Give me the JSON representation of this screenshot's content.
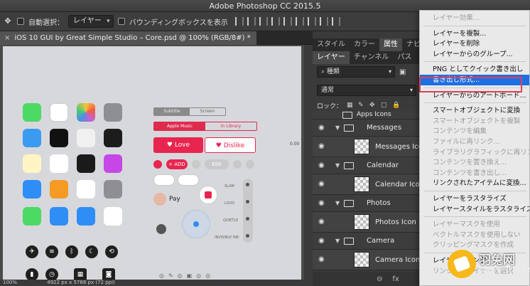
{
  "app_title": "Adobe Photoshop CC 2015.5",
  "options_bar": {
    "auto_select_label": "自動選択：",
    "auto_select_value": "レイヤー",
    "bounding_box_label": "バウンディングボックスを表示"
  },
  "document": {
    "tab_title": "iOS 10 GUI by Great Simple Studio – Core.psd @ 100% (RGB/8#) *",
    "close_symbol": "×"
  },
  "canvas_ui": {
    "seg1": [
      "Subtitle",
      "Screen"
    ],
    "seg2": [
      "Apple Music",
      "In Library"
    ],
    "love": "Love",
    "dislike": "Dislike",
    "add": "ADD",
    "edit": "Edit",
    "pay": "Pay",
    "slider_labels": [
      "SLAM",
      "LOUD",
      "QUIETLE",
      "INVISIBLE INK"
    ],
    "ruler_value": "0.00"
  },
  "panels": {
    "top_tabs": [
      "スタイル",
      "カラー",
      "属性",
      "ナビ"
    ],
    "layer_tabs": [
      "レイヤー",
      "チャンネル",
      "パス"
    ],
    "filter_label": "種類",
    "blend_mode": "通常",
    "lock_label": "ロック：",
    "layers": [
      {
        "name": "Apps Icons",
        "type": "group",
        "level": 0
      },
      {
        "name": "Messages",
        "type": "group",
        "level": 1
      },
      {
        "name": "Messages Icon",
        "type": "smart",
        "level": 2
      },
      {
        "name": "Calendar",
        "type": "group",
        "level": 1
      },
      {
        "name": "Calendar Icon",
        "type": "smart",
        "level": 2
      },
      {
        "name": "Photos",
        "type": "group",
        "level": 1
      },
      {
        "name": "Photos Icon",
        "type": "smart",
        "level": 2
      },
      {
        "name": "Camera",
        "type": "group",
        "level": 1
      },
      {
        "name": "Camera Icon",
        "type": "smart",
        "level": 2
      }
    ],
    "footer_icons": [
      "link-icon",
      "fx-icon"
    ]
  },
  "context_menu": {
    "items": [
      {
        "label": "レイヤー効果...",
        "disabled": true,
        "selected": false
      },
      {
        "sep": true
      },
      {
        "label": "レイヤーを複製...",
        "disabled": false,
        "selected": false
      },
      {
        "label": "レイヤーを削除",
        "disabled": false,
        "selected": false
      },
      {
        "label": "レイヤーからのグループ...",
        "disabled": false,
        "selected": false
      },
      {
        "sep": true
      },
      {
        "label": "PNG としてクイック書き出し",
        "disabled": false,
        "selected": false
      },
      {
        "label": "書き出し形式...",
        "disabled": false,
        "selected": true
      },
      {
        "sep": true
      },
      {
        "label": "レイヤーからのアートボード...",
        "disabled": false,
        "selected": false
      },
      {
        "sep": true
      },
      {
        "label": "スマートオブジェクトに変換",
        "disabled": false,
        "selected": false
      },
      {
        "label": "スマートオブジェクトを複製",
        "disabled": true,
        "selected": false
      },
      {
        "label": "コンテンツを編集",
        "disabled": true,
        "selected": false
      },
      {
        "label": "ファイルに再リンク...",
        "disabled": true,
        "selected": false
      },
      {
        "label": "ライブラリグラフィックに再リンク",
        "disabled": true,
        "selected": false
      },
      {
        "label": "コンテンツを置き換え...",
        "disabled": true,
        "selected": false
      },
      {
        "label": "コンテンツを書き出し...",
        "disabled": true,
        "selected": false
      },
      {
        "label": "リンクされたアイテムに変換...",
        "disabled": false,
        "selected": false
      },
      {
        "sep": true
      },
      {
        "label": "レイヤーをラスタライズ",
        "disabled": false,
        "selected": false
      },
      {
        "label": "レイヤースタイルをラスタライズ",
        "disabled": false,
        "selected": false
      },
      {
        "sep": true
      },
      {
        "label": "レイヤーマスクを使用",
        "disabled": true,
        "selected": false
      },
      {
        "label": "ベクトルマスクを使用しない",
        "disabled": true,
        "selected": false
      },
      {
        "label": "クリッピングマスクを作成",
        "disabled": true,
        "selected": false
      },
      {
        "sep": true
      },
      {
        "label": "レイヤーのリンク",
        "disabled": false,
        "selected": false
      },
      {
        "label": "リンクしたレイヤーを選択",
        "disabled": true,
        "selected": false
      }
    ]
  },
  "status": {
    "zoom": "100%",
    "doc_size": "4922 px x 5768 px (72 ppi)"
  },
  "watermark": {
    "cn": "羽兔网",
    "url": "WWW.YUTU.CN"
  },
  "colors": {
    "accent_red": "#e8254e",
    "menu_selected": "#1e6fe0",
    "highlight_box": "#e0405a"
  }
}
